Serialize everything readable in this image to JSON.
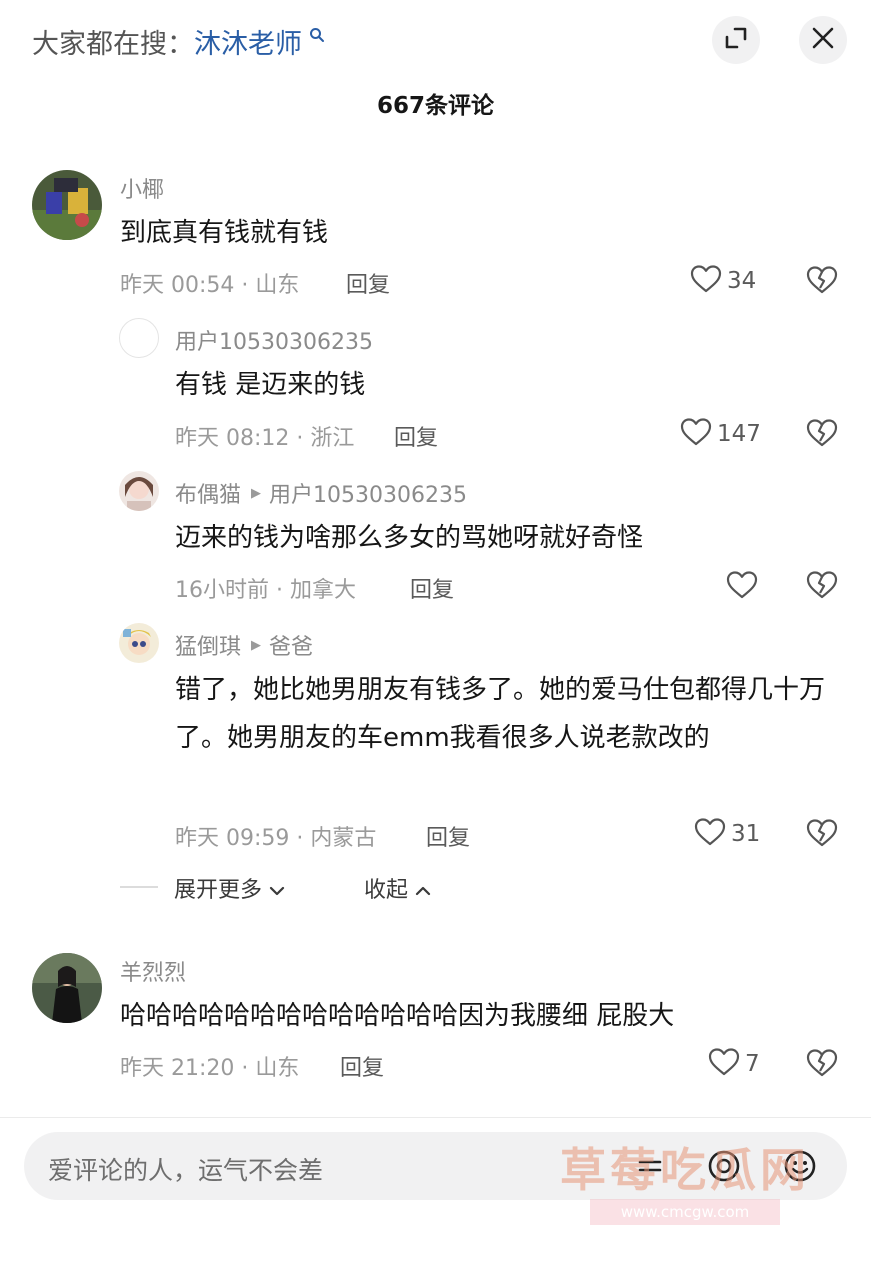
{
  "header": {
    "search_prefix": "大家都在搜：",
    "search_keyword": "沐沐老师",
    "count_title": "667条评论"
  },
  "comments": [
    {
      "user": "小椰",
      "text": "到底真有钱就有钱",
      "meta": "昨天 00:54 · 山东",
      "reply": "回复",
      "likes": "34"
    },
    {
      "user": "用户10530306235",
      "text": "有钱 是迈来的钱",
      "meta": "昨天 08:12 · 浙江",
      "reply": "回复",
      "likes": "147"
    },
    {
      "user": "布偶猫",
      "reply_to": "用户10530306235",
      "text": "迈来的钱为啥那么多女的骂她呀就好奇怪",
      "meta": "16小时前 · 加拿大",
      "reply": "回复",
      "likes": ""
    },
    {
      "user": "猛倒琪",
      "reply_to": "爸爸",
      "text": "错了，她比她男朋友有钱多了。她的爱马仕包都得几十万了。她男朋友的车emm我看很多人说老款改的",
      "meta": "昨天 09:59 · 内蒙古",
      "reply": "回复",
      "likes": "31"
    },
    {
      "user": "羊烈烈",
      "text": "哈哈哈哈哈哈哈哈哈哈哈哈哈因为我腰细 屁股大",
      "meta": "昨天 21:20 · 山东",
      "reply": "回复",
      "likes": "7"
    }
  ],
  "thread_controls": {
    "expand_more": "展开更多",
    "collapse": "收起"
  },
  "composer": {
    "placeholder": "爱评论的人，运气不会差"
  },
  "watermark": {
    "text": "草莓吃瓜网",
    "url": "www.cmcgw.com"
  },
  "icons": [
    "expand-icon",
    "close-icon",
    "search-icon",
    "heart-icon",
    "broken-heart-icon",
    "chevron-down-icon",
    "chevron-up-icon",
    "emoji-icon"
  ],
  "colors": {
    "keyword": "#2a5ea6",
    "muted_text": "#8a8a8a",
    "input_bg": "#f1f1f2"
  }
}
